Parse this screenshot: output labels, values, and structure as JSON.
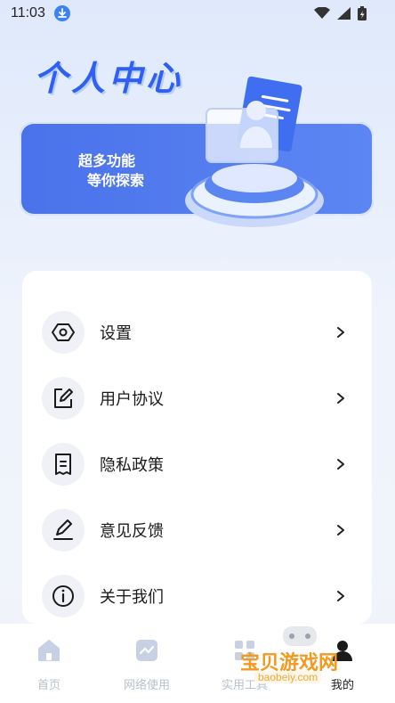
{
  "status_bar": {
    "time": "11:03"
  },
  "header": {
    "title": "个人中心"
  },
  "hero": {
    "line1": "超多功能",
    "line2": "等你探索"
  },
  "menu": {
    "items": [
      {
        "label": "设置",
        "icon": "hexagon-settings-icon"
      },
      {
        "label": "用户协议",
        "icon": "edit-document-icon"
      },
      {
        "label": "隐私政策",
        "icon": "receipt-document-icon"
      },
      {
        "label": "意见反馈",
        "icon": "pen-feedback-icon"
      },
      {
        "label": "关于我们",
        "icon": "info-icon"
      }
    ]
  },
  "tabs": [
    {
      "label": "首页",
      "icon": "home-icon"
    },
    {
      "label": "网络使用",
      "icon": "network-chart-icon"
    },
    {
      "label": "实用工具",
      "icon": "tools-icon"
    },
    {
      "label": "我的",
      "icon": "profile-icon"
    }
  ],
  "watermark": {
    "text": "宝贝游戏网",
    "url": "baobeiy.com"
  },
  "colors": {
    "accent": "#2f60f2",
    "card": "#4a72ea",
    "tab_inactive": "#b8bfcc"
  }
}
